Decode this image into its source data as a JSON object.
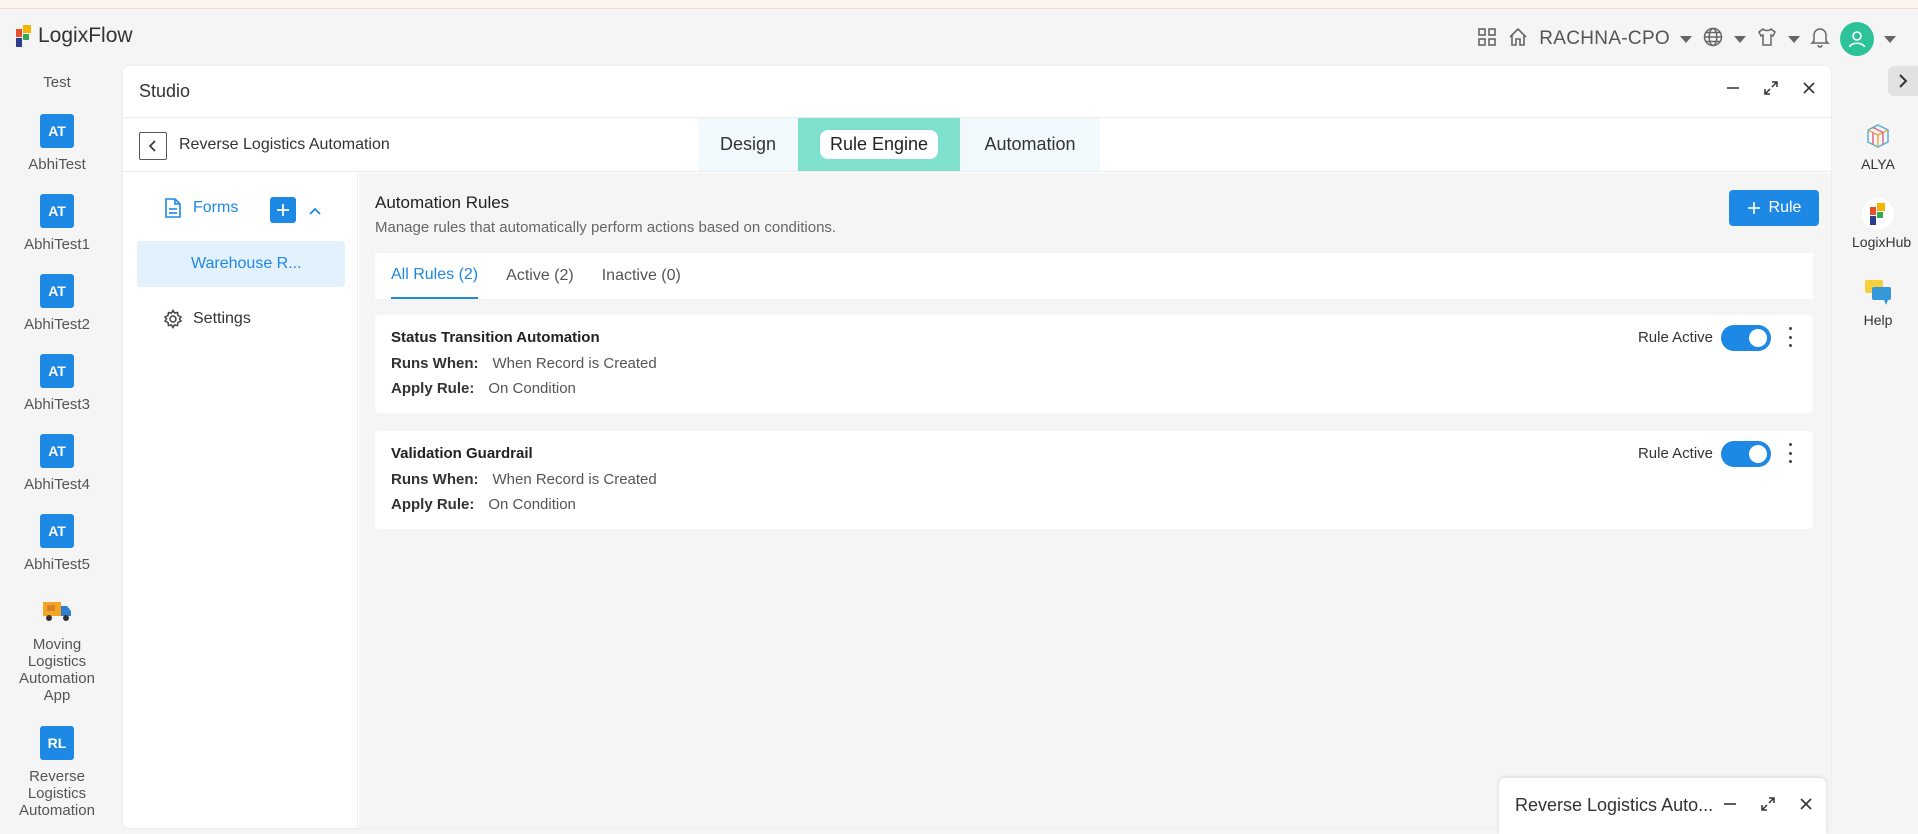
{
  "brand": {
    "name": "LogixFlow"
  },
  "topbar": {
    "org": "RACHNA-CPO",
    "icons": [
      "apps-grid-icon",
      "home-icon",
      "globe-icon",
      "shirt-icon",
      "bell-icon",
      "user-avatar-icon"
    ]
  },
  "left_rail": {
    "items": [
      {
        "label": "Test",
        "initials": ""
      },
      {
        "label": "AbhiTest",
        "initials": "AT"
      },
      {
        "label": "AbhiTest1",
        "initials": "AT"
      },
      {
        "label": "AbhiTest2",
        "initials": "AT"
      },
      {
        "label": "AbhiTest3",
        "initials": "AT"
      },
      {
        "label": "AbhiTest4",
        "initials": "AT"
      },
      {
        "label": "AbhiTest5",
        "initials": "AT"
      },
      {
        "label": "Moving Logistics Automation App",
        "initials": ""
      },
      {
        "label": "Reverse Logistics Automation",
        "initials": "RL"
      }
    ]
  },
  "right_rail": {
    "items": [
      {
        "label": "ALYA"
      },
      {
        "label": "LogixHub"
      },
      {
        "label": "Help"
      }
    ]
  },
  "studio": {
    "title": "Studio",
    "app_name": "Reverse Logistics Automation",
    "tabs": [
      {
        "label": "Design"
      },
      {
        "label": "Rule Engine"
      },
      {
        "label": "Automation"
      }
    ],
    "forms": {
      "label": "Forms",
      "items": [
        {
          "label": "Warehouse R..."
        }
      ],
      "settings_label": "Settings"
    }
  },
  "rules": {
    "title": "Automation Rules",
    "description": "Manage rules that automatically perform actions based on conditions.",
    "add_button": "Rule",
    "filters": [
      {
        "label": "All Rules (2)"
      },
      {
        "label": "Active (2)"
      },
      {
        "label": "Inactive (0)"
      }
    ],
    "runs_when_label": "Runs When:",
    "apply_rule_label": "Apply Rule:",
    "active_label": "Rule Active",
    "list": [
      {
        "name": "Status Transition Automation",
        "runs_when": "When Record is Created",
        "apply_rule": "On Condition",
        "active": true
      },
      {
        "name": "Validation Guardrail",
        "runs_when": "When Record is Created",
        "apply_rule": "On Condition",
        "active": true
      }
    ]
  },
  "minimized_window": {
    "title": "Reverse Logistics Auto..."
  },
  "colors": {
    "accent": "#1e88e5",
    "rule_tab": "#7ee0cd",
    "avatar": "#2ec29a"
  }
}
